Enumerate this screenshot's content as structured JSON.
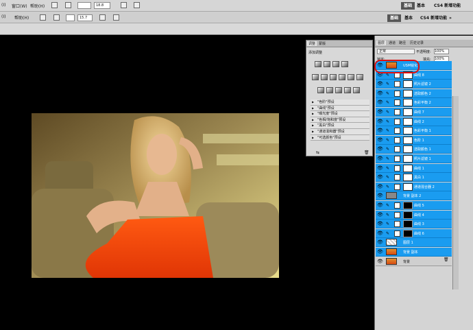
{
  "menubar": {
    "items": [
      "(I)",
      "窗口(W)",
      "帮助(H)"
    ],
    "items2": [
      "(I)",
      "帮助(H)"
    ],
    "zoom1": "18.8",
    "zoom2": "15.7"
  },
  "workspace": {
    "active": "基础",
    "basic": "基本",
    "new": "CS4 新增功能",
    "more": "»"
  },
  "adjustments": {
    "tabs": [
      "调整",
      "蒙版"
    ],
    "title": "添加调整",
    "presets": [
      "\"色阶\"预设",
      "\"曲线\"预设",
      "\"曝光度\"预设",
      "\"色相/饱和度\"预设",
      "\"黑白\"预设",
      "\"通道混和器\"预设",
      "\"可选颜色\"预设"
    ]
  },
  "layers": {
    "tabs": [
      "图层",
      "通道",
      "路径",
      "历史记录"
    ],
    "blend_mode": "正常",
    "opacity_label": "不透明度:",
    "opacity": "100%",
    "lock_label": "锁定:",
    "fill_label": "填充:",
    "fill": "100%",
    "items": [
      {
        "name": "USM锐化",
        "style": "photo",
        "mask": false,
        "selected": true
      },
      {
        "name": "曲线 8",
        "style": "white",
        "mask": true
      },
      {
        "name": "照片滤镜 2",
        "style": "white",
        "mask": true
      },
      {
        "name": "选取颜色 2",
        "style": "white",
        "mask": true
      },
      {
        "name": "色彩平衡 2",
        "style": "white",
        "mask": true
      },
      {
        "name": "曲线 7",
        "style": "white",
        "mask": true
      },
      {
        "name": "曲线 2",
        "style": "white",
        "mask": true
      },
      {
        "name": "色彩平衡 1",
        "style": "white",
        "mask": true
      },
      {
        "name": "色阶 1",
        "style": "white",
        "mask": true
      },
      {
        "name": "选取颜色 1",
        "style": "white",
        "mask": true
      },
      {
        "name": "照片滤镜 1",
        "style": "white",
        "mask": true
      },
      {
        "name": "曲线 1",
        "style": "white",
        "mask": true
      },
      {
        "name": "黑白 1",
        "style": "white",
        "mask": true
      },
      {
        "name": "通道混合器 2",
        "style": "white",
        "mask": true
      },
      {
        "name": "背景 副本 2",
        "style": "grey",
        "mask": false
      },
      {
        "name": "曲线 5",
        "style": "white",
        "mask": "black"
      },
      {
        "name": "曲线 4",
        "style": "white",
        "mask": "black"
      },
      {
        "name": "曲线 3",
        "style": "white",
        "mask": "black"
      },
      {
        "name": "曲线 6",
        "style": "white",
        "mask": "black"
      },
      {
        "name": "图层 1",
        "style": "check",
        "mask": false
      },
      {
        "name": "背景 副本",
        "style": "photo",
        "mask": false
      },
      {
        "name": "背景",
        "style": "photo",
        "mask": false,
        "plain": true
      }
    ]
  }
}
